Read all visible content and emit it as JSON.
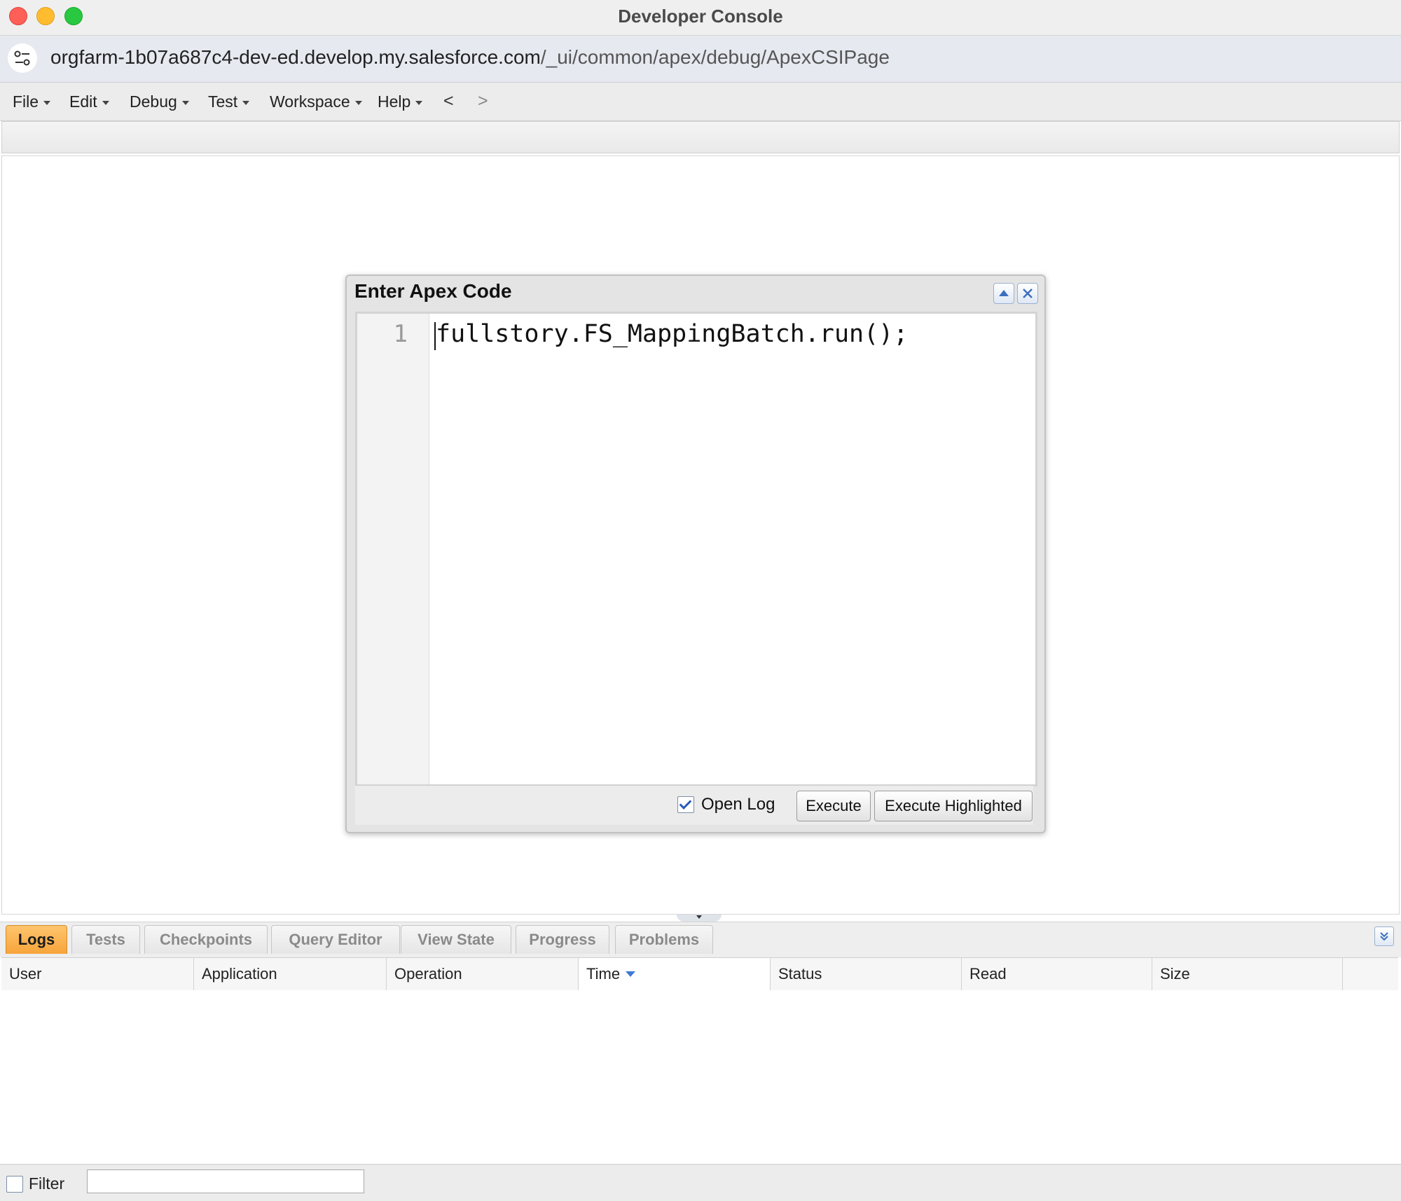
{
  "window": {
    "title": "Developer Console"
  },
  "browser": {
    "url_host": "orgfarm-1b07a687c4-dev-ed.develop.my.salesforce.com",
    "url_path": "/_ui/common/apex/debug/ApexCSIPage"
  },
  "menu": {
    "items": [
      {
        "label": "File"
      },
      {
        "label": "Edit"
      },
      {
        "label": "Debug"
      },
      {
        "label": "Test"
      },
      {
        "label": "Workspace"
      },
      {
        "label": "Help"
      }
    ],
    "back": "<",
    "forward": ">"
  },
  "dialog": {
    "title": "Enter Apex Code",
    "line_number": "1",
    "code": "fullstory.FS_MappingBatch.run();",
    "open_log_label": "Open Log",
    "open_log_checked": true,
    "execute_label": "Execute",
    "execute_highlighted_label": "Execute Highlighted"
  },
  "tabs": [
    {
      "label": "Logs",
      "active": true
    },
    {
      "label": "Tests",
      "active": false
    },
    {
      "label": "Checkpoints",
      "active": false
    },
    {
      "label": "Query Editor",
      "active": false
    },
    {
      "label": "View State",
      "active": false
    },
    {
      "label": "Progress",
      "active": false
    },
    {
      "label": "Problems",
      "active": false
    }
  ],
  "table": {
    "columns": [
      "User",
      "Application",
      "Operation",
      "Time",
      "Status",
      "Read",
      "Size"
    ],
    "sorted_column": "Time",
    "rows": []
  },
  "filter": {
    "label": "Filter",
    "checked": false,
    "value": ""
  },
  "colors": {
    "active_tab": "#f7a43a",
    "accent_blue": "#3d7ad6"
  }
}
